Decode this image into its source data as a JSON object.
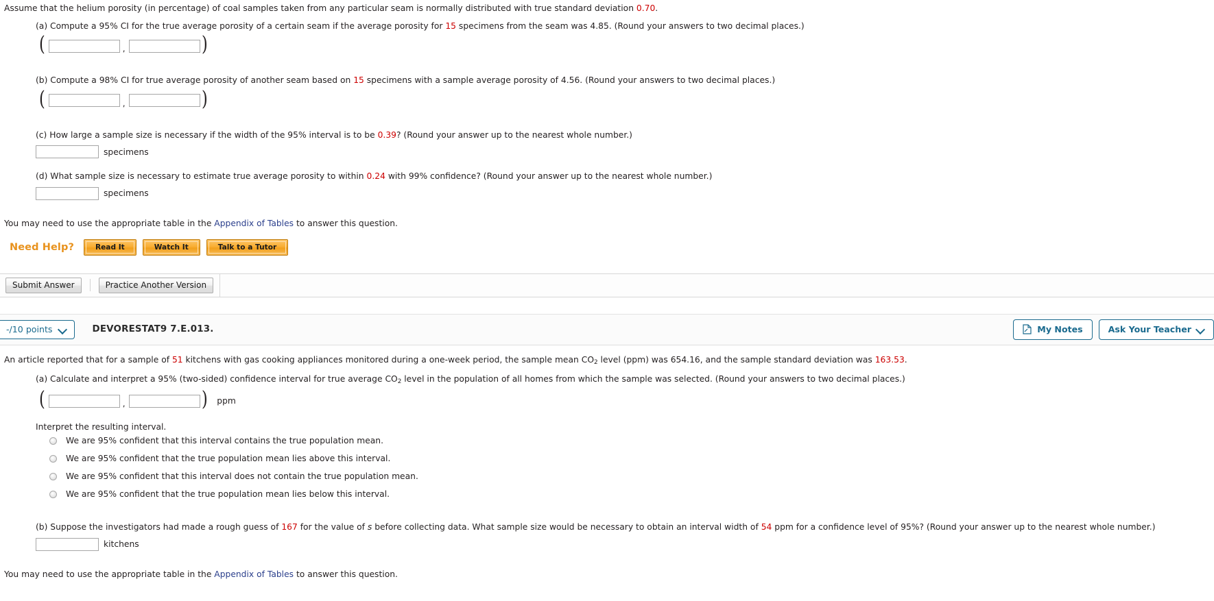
{
  "question1": {
    "stem_pre": "Assume that the helium porosity (in percentage) of coal samples taken from any particular seam is normally distributed with true standard deviation ",
    "stem_value": "0.70",
    "stem_post": ".",
    "parts": {
      "a": {
        "pre": "(a) Compute a 95% CI for the true average porosity of a certain seam if the average porosity for ",
        "value": "15",
        "post": " specimens from the seam was 4.85. (Round your answers to two decimal places.)",
        "lower_value": "",
        "upper_value": ""
      },
      "b": {
        "pre": "(b) Compute a 98% CI for true average porosity of another seam based on ",
        "value": "15",
        "post": " specimens with a sample average porosity of 4.56. (Round your answers to two decimal places.)",
        "lower_value": "",
        "upper_value": ""
      },
      "c": {
        "pre": "(c) How large a sample size is necessary if the width of the 95% interval is to be ",
        "value": "0.39",
        "post": "? (Round your answer up to the nearest whole number.)",
        "answer_value": "",
        "unit": "specimens"
      },
      "d": {
        "pre": "(d) What sample size is necessary to estimate true average porosity to within ",
        "value": "0.24",
        "post": " with 99% confidence? (Round your answer up to the nearest whole number.)",
        "answer_value": "",
        "unit": "specimens"
      }
    },
    "appendix_pre": "You may need to use the appropriate table in the ",
    "appendix_link": "Appendix of Tables",
    "appendix_post": " to answer this question.",
    "need_help_label": "Need Help?",
    "help_buttons": [
      "Read It",
      "Watch It",
      "Talk to a Tutor"
    ],
    "submit_label": "Submit Answer",
    "practice_label": "Practice Another Version"
  },
  "question2": {
    "header": {
      "points": "-/10 points",
      "question_id": "DEVORESTAT9 7.E.013.",
      "my_notes": "My Notes",
      "ask_teacher": "Ask Your Teacher"
    },
    "stem": {
      "p1": "An article reported that for a sample of ",
      "v1": "51",
      "p2": " kitchens with gas cooking appliances monitored during a one-week period, the sample mean CO",
      "sub1": "2",
      "p3": " level (ppm) was 654.16, and the sample standard deviation was ",
      "v2": "163.53",
      "p4": "."
    },
    "parts": {
      "a": {
        "p1": "(a) Calculate and interpret a 95% (two-sided) confidence interval for true average CO",
        "sub1": "2",
        "p2": " level in the population of all homes from which the sample was selected. (Round your answers to two decimal places.)",
        "lower_value": "",
        "upper_value": "",
        "unit": "ppm",
        "interpret_label": "Interpret the resulting interval.",
        "options": [
          "We are 95% confident that this interval contains the true population mean.",
          "We are 95% confident that the true population mean lies above this interval.",
          "We are 95% confident that this interval does not contain the true population mean.",
          "We are 95% confident that the true population mean lies below this interval."
        ]
      },
      "b": {
        "p1": "(b) Suppose the investigators had made a rough guess of ",
        "v1": "167",
        "p2": " for the value of ",
        "italic": "s",
        "p3": " before collecting data. What sample size would be necessary to obtain an interval width of ",
        "v2": "54",
        "p4": " ppm for a confidence level of 95%? (Round your answer up to the nearest whole number.)",
        "answer_value": "",
        "unit": "kitchens"
      }
    },
    "appendix_pre": "You may need to use the appropriate table in the ",
    "appendix_link": "Appendix of Tables",
    "appendix_post": " to answer this question."
  },
  "colors": {
    "red_value": "#cc0000",
    "link_blue": "#2b3f8c",
    "accent_teal": "#1a6a8e",
    "help_orange": "#e8921d"
  }
}
